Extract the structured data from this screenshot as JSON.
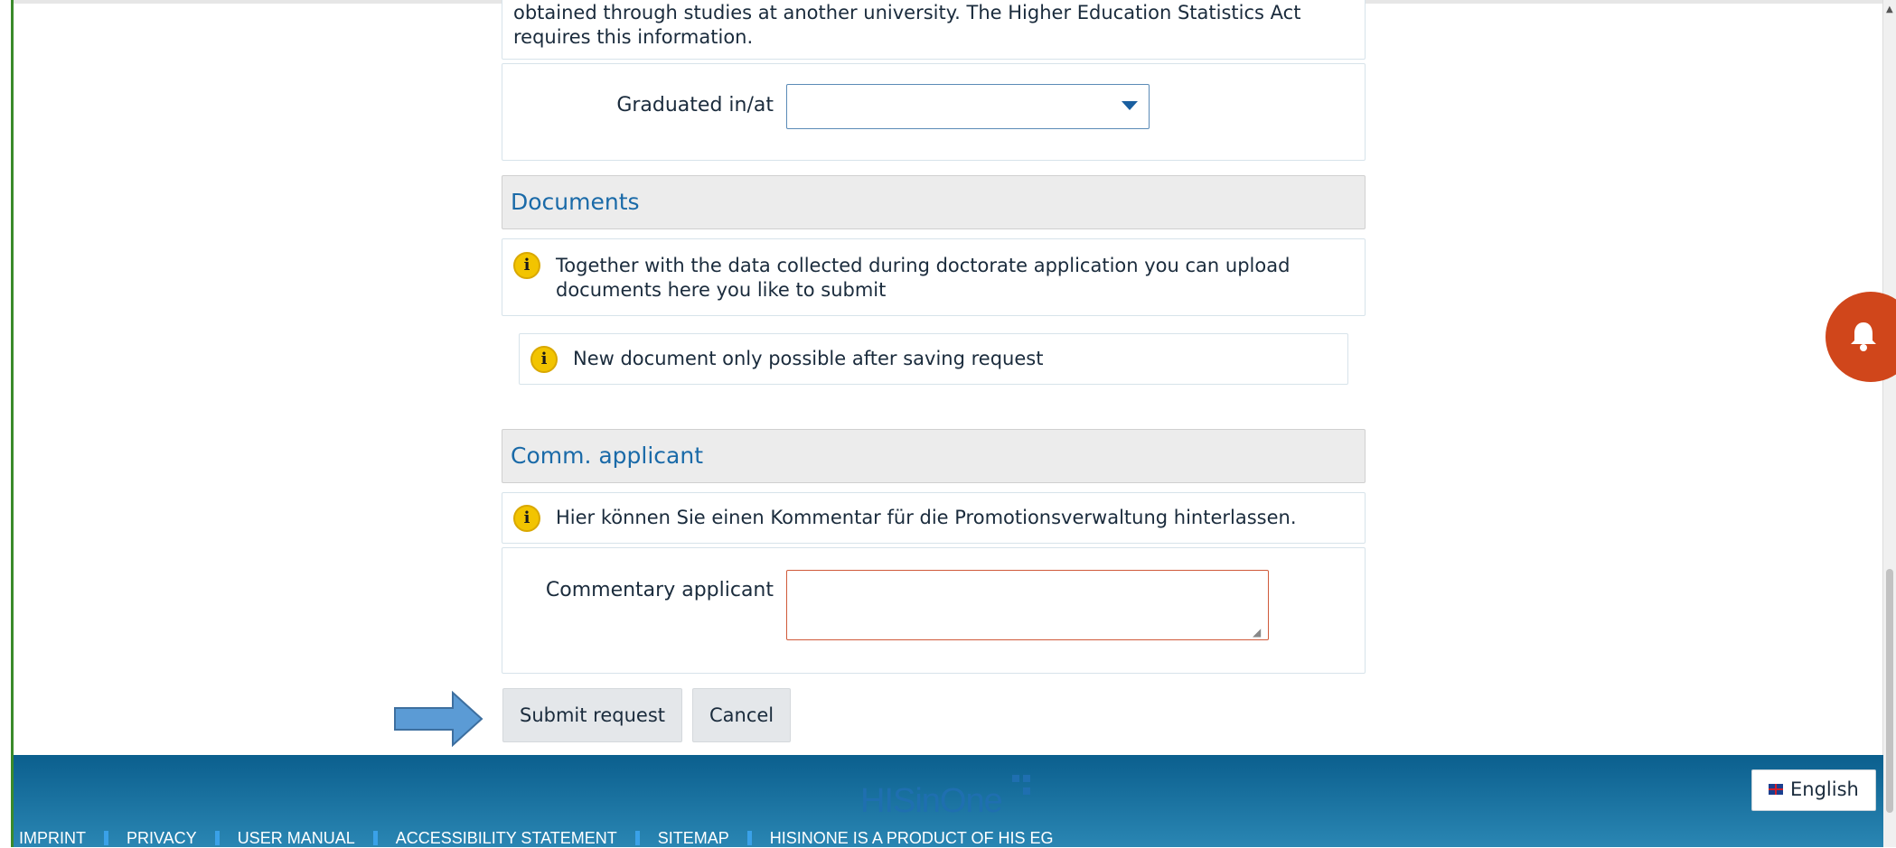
{
  "intro": {
    "text": "obtained through studies at another university. The Higher Education Statistics Act requires this information."
  },
  "graduated": {
    "label": "Graduated in/at",
    "value": ""
  },
  "documents": {
    "title": "Documents",
    "info": "Together with the data collected during doctorate application you can upload documents here you like to submit",
    "notice": "New document only possible after saving request"
  },
  "comm": {
    "title": "Comm. applicant",
    "info": "Hier können Sie einen Kommentar für die Promotionsverwaltung hinterlassen.",
    "field_label": "Commentary applicant",
    "field_value": ""
  },
  "actions": {
    "submit_label": "Submit request",
    "cancel_label": "Cancel"
  },
  "footer": {
    "logo": "HISinOne",
    "links": [
      "IMPRINT",
      "PRIVACY",
      "USER MANUAL",
      "ACCESSIBILITY STATEMENT",
      "SITEMAP",
      "HISINONE IS A PRODUCT OF HIS EG"
    ]
  },
  "language": {
    "label": "English",
    "flag": "uk-flag-icon"
  },
  "icons": {
    "info": "info-icon",
    "notification": "bell-icon",
    "pointer": "arrow-right-icon"
  },
  "colors": {
    "accent": "#1a6aa8",
    "footer": "#0b5f8e",
    "notification": "#d0461b",
    "info_icon": "#f2c400",
    "field_error_border": "#d05a3a",
    "arrow": "#5b9bd5"
  }
}
